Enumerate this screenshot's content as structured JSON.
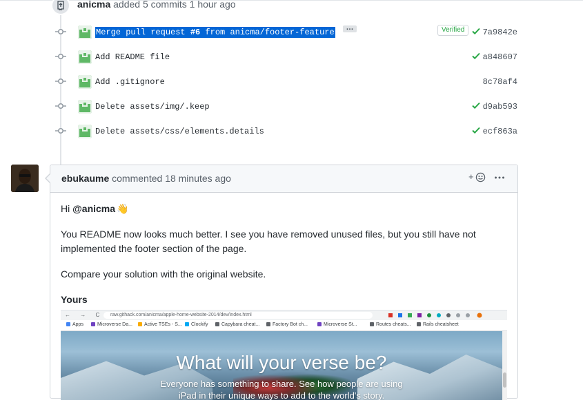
{
  "push": {
    "author": "anicma",
    "action": "added 5 commits",
    "time": "1 hour ago"
  },
  "commits": [
    {
      "message_prefix": "Merge pull request ",
      "issue": "#6",
      "message_suffix": " from anicma/footer-feature",
      "expand": "…",
      "verified": "Verified",
      "status": "success",
      "sha": "7a9842e",
      "selected": true
    },
    {
      "message": "Add README file",
      "status": "success",
      "sha": "a848607"
    },
    {
      "message": "Add .gitignore",
      "status": "none",
      "sha": "8c78af4"
    },
    {
      "message": "Delete assets/img/.keep",
      "status": "success",
      "sha": "d9ab593"
    },
    {
      "message": "Delete assets/css/elements.details",
      "status": "success",
      "sha": "ecf863a"
    }
  ],
  "comment": {
    "author": "ebukaume",
    "action": "commented",
    "time": "18 minutes ago",
    "reaction_label": "+",
    "body": {
      "greeting": "Hi ",
      "mention": "@anicma",
      "wave": "👋",
      "para1": "You README now looks much better. I see you have removed unused files, but you still have not implemented the footer section of the page.",
      "para2": "Compare your solution with the original website.",
      "heading": "Yours"
    },
    "screenshot": {
      "nav": "← → C ⌂",
      "url": "raw.githack.com/anicma/apple-home-website-2014/dev/index.html",
      "bookmarks": [
        "Apps",
        "Microverse Da...",
        "Active TSEs - S...",
        "Clockify",
        "Capybara cheat...",
        "Factory Bot ch...",
        "Microverse St...",
        "Routes cheats...",
        "Rails cheatsheet"
      ],
      "headline": "What will your verse be?",
      "subline1": "Everyone has something to share. See how people are using",
      "subline2": "iPad in their unique ways to add to the world's story."
    }
  },
  "colors": {
    "success": "#28a745",
    "selection": "#0366d6",
    "avatar_green": "#5fb866"
  }
}
